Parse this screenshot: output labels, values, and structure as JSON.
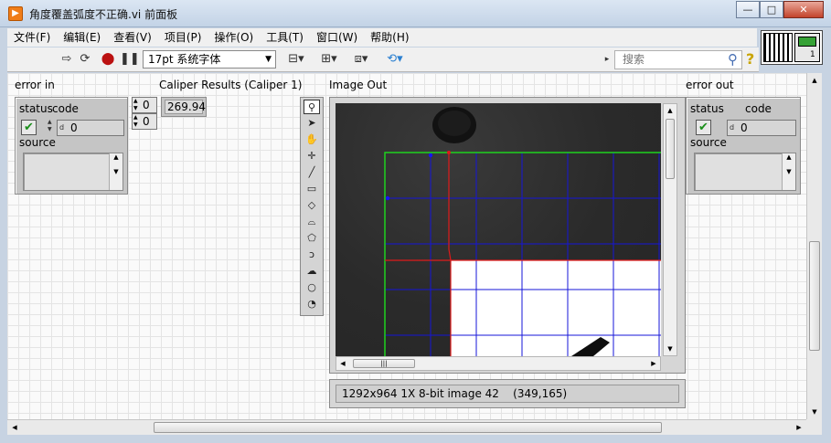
{
  "window": {
    "title": "角度覆盖弧度不正确.vi 前面板",
    "minimize": "—",
    "maximize": "□",
    "close": "✕"
  },
  "menu": [
    "文件(F)",
    "编辑(E)",
    "查看(V)",
    "项目(P)",
    "操作(O)",
    "工具(T)",
    "窗口(W)",
    "帮助(H)"
  ],
  "toolbar": {
    "font": "17pt 系统字体",
    "search_placeholder": "搜索",
    "help": "?"
  },
  "vi_icon": {
    "number": "1"
  },
  "error_in": {
    "label": "error in",
    "status_label": "status",
    "code_label": "code",
    "code_value": "0",
    "source_label": "source"
  },
  "caliper": {
    "label": "Caliper Results (Caliper 1)",
    "index_1": "0",
    "index_2": "0",
    "value": "269.94"
  },
  "image_out": {
    "label": "Image Out",
    "status": "1292x964 1X 8-bit image 42    (349,165)"
  },
  "error_out": {
    "label": "error out",
    "status_label": "status",
    "code_label": "code",
    "code_value": "0",
    "source_label": "source"
  },
  "palette_tools": [
    "zoom-tool",
    "pointer-tool",
    "pan-tool",
    "point-tool",
    "line-tool",
    "rectangle-tool",
    "rotated-rectangle-tool",
    "annulus-tool",
    "polygon-tool",
    "freehand-tool",
    "freehand-region-tool",
    "oval-tool",
    "broken-annulus-tool"
  ]
}
